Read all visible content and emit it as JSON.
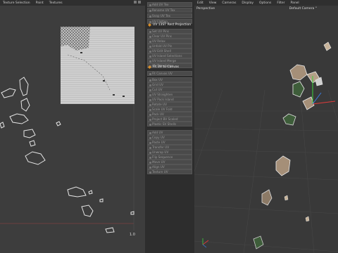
{
  "uv_editor": {
    "menu": [
      "Texture Selection",
      "Paint",
      "Textures"
    ],
    "axis_one": "1.0"
  },
  "panel": {
    "items_top": [
      "Add UV Tex",
      "Rename UV Tex",
      "Snap UV Tex",
      "UV Flatten"
    ],
    "section1": "UV 13ST Rest Projection",
    "items_mid": [
      "Set UV Pins",
      "Clear UV Pins",
      "UV Relax",
      "Unfold UV Pin",
      "UV Edit Shell",
      "UV Island Selections",
      "UV Island Merge",
      "UV Transforms"
    ],
    "section2": "Fit UV to Canvas",
    "items_low": [
      "Fit Canvas UV",
      "Box UV",
      "Grid UV",
      "Cut UV",
      "UV Straighten",
      "UV Pack Island",
      "Rotate UV",
      "Scale UV Fold",
      "Pack UV",
      "Project BV Scaled",
      "Plastic SV Shells"
    ],
    "items_bottom": [
      "Add UV",
      "Copy UV",
      "Paste UV",
      "Transfer UV",
      "Unwrap UV",
      "Flip Sequence",
      "Move UV",
      "Align UV",
      "Texture UV"
    ]
  },
  "viewport": {
    "menu": [
      "Edit",
      "View",
      "Cameras",
      "Display",
      "Options",
      "Filter",
      "Panel"
    ],
    "name": "Perspective",
    "camera": "Default Camera °"
  },
  "colors": {
    "accent": "#e08a2a",
    "panel_bg": "#2d2d2d",
    "view_bg": "#3b3b3b"
  }
}
